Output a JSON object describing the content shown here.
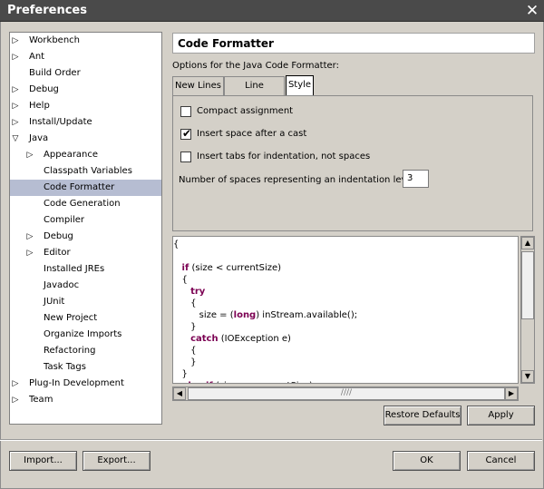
{
  "window": {
    "title": "Preferences",
    "close_glyph": "✕"
  },
  "tree": {
    "items": [
      {
        "label": "Workbench",
        "expander": "collapsed",
        "selected": false
      },
      {
        "label": "Ant",
        "expander": "collapsed",
        "selected": false
      },
      {
        "label": "Build Order",
        "expander": "none",
        "selected": false
      },
      {
        "label": "Debug",
        "expander": "collapsed",
        "selected": false
      },
      {
        "label": "Help",
        "expander": "collapsed",
        "selected": false
      },
      {
        "label": "Install/Update",
        "expander": "collapsed",
        "selected": false
      },
      {
        "label": "Java",
        "expander": "expanded",
        "selected": false
      },
      {
        "label": "Appearance",
        "expander": "collapsed",
        "selected": false
      },
      {
        "label": "Classpath Variables",
        "expander": "none",
        "selected": false
      },
      {
        "label": "Code Formatter",
        "expander": "none",
        "selected": true
      },
      {
        "label": "Code Generation",
        "expander": "none",
        "selected": false
      },
      {
        "label": "Compiler",
        "expander": "none",
        "selected": false
      },
      {
        "label": "Debug",
        "expander": "collapsed",
        "selected": false
      },
      {
        "label": "Editor",
        "expander": "collapsed",
        "selected": false
      },
      {
        "label": "Installed JREs",
        "expander": "none",
        "selected": false
      },
      {
        "label": "Javadoc",
        "expander": "none",
        "selected": false
      },
      {
        "label": "JUnit",
        "expander": "none",
        "selected": false
      },
      {
        "label": "New Project",
        "expander": "none",
        "selected": false
      },
      {
        "label": "Organize Imports",
        "expander": "none",
        "selected": false
      },
      {
        "label": "Refactoring",
        "expander": "none",
        "selected": false
      },
      {
        "label": "Task Tags",
        "expander": "none",
        "selected": false
      },
      {
        "label": "Plug-In Development",
        "expander": "collapsed",
        "selected": false
      },
      {
        "label": "Team",
        "expander": "collapsed",
        "selected": false
      }
    ]
  },
  "page": {
    "title": "Code Formatter",
    "options_label": "Options for the Java Code Formatter:",
    "tabs": [
      {
        "label": "New Lines",
        "active": false
      },
      {
        "label": "Line Splitting",
        "active": false
      },
      {
        "label": "Style",
        "active": true
      }
    ],
    "style": {
      "compact_assignment": {
        "label": "Compact assignment",
        "checked": false
      },
      "space_after_cast": {
        "label": "Insert space after a cast",
        "checked": true
      },
      "tabs_indentation": {
        "label": "Insert tabs for indentation, not spaces",
        "checked": false
      },
      "spaces_label": "Number of spaces representing an indentation level:",
      "spaces_value": "3"
    },
    "preview_lines": [
      [
        {
          "t": "{",
          "kw": false
        }
      ],
      [
        {
          "t": "",
          "kw": false
        }
      ],
      [
        {
          "t": "   ",
          "kw": false
        },
        {
          "t": "if",
          "kw": true
        },
        {
          "t": " (size < currentSize)",
          "kw": false
        }
      ],
      [
        {
          "t": "   {",
          "kw": false
        }
      ],
      [
        {
          "t": "      ",
          "kw": false
        },
        {
          "t": "try",
          "kw": true
        }
      ],
      [
        {
          "t": "      {",
          "kw": false
        }
      ],
      [
        {
          "t": "         size = (",
          "kw": false
        },
        {
          "t": "long",
          "kw": true
        },
        {
          "t": ") inStream.available();",
          "kw": false
        }
      ],
      [
        {
          "t": "      }",
          "kw": false
        }
      ],
      [
        {
          "t": "      ",
          "kw": false
        },
        {
          "t": "catch",
          "kw": true
        },
        {
          "t": " (IOException e)",
          "kw": false
        }
      ],
      [
        {
          "t": "      {",
          "kw": false
        }
      ],
      [
        {
          "t": "      }",
          "kw": false
        }
      ],
      [
        {
          "t": "   }",
          "kw": false
        }
      ],
      [
        {
          "t": "   ",
          "kw": false
        },
        {
          "t": "else if",
          "kw": true
        },
        {
          "t": " (size == currentSize)",
          "kw": false
        }
      ]
    ],
    "restore_defaults_label": "Restore Defaults",
    "apply_label": "Apply"
  },
  "footer": {
    "import_label": "Import...",
    "export_label": "Export...",
    "ok_label": "OK",
    "cancel_label": "Cancel"
  },
  "scrollbar": {
    "up_glyph": "▲",
    "down_glyph": "▼",
    "left_glyph": "◀",
    "right_glyph": "▶",
    "grip_glyph": "////"
  },
  "icons": {
    "collapsed": "▷",
    "expanded": "▽",
    "check": "✔"
  },
  "colors": {
    "selection": "#b6bdd2",
    "keyword": "#7b0052",
    "titlebar": "#4a4a4a"
  }
}
